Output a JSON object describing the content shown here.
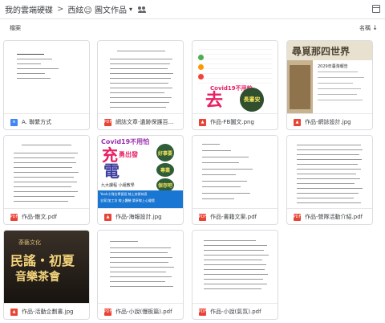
{
  "breadcrumb": {
    "root": "我的雲端硬碟",
    "sep": ">",
    "folder": "西絃☺ 圖文作品",
    "caret": "▾"
  },
  "section": {
    "left": "檔案",
    "right": "名稱",
    "sort_arrow": "↓"
  },
  "files": [
    {
      "name": "A. 聯繫方式",
      "type": "doc"
    },
    {
      "name": "網誌文章-遺跡保護百年.pdf",
      "type": "pdf"
    },
    {
      "name": "作品-FB圖文.png",
      "type": "img"
    },
    {
      "name": "作品-網誌設計.jpg",
      "type": "img"
    },
    {
      "name": "作品-散文.pdf",
      "type": "pdf"
    },
    {
      "name": "作品-海報設計.jpg",
      "type": "img"
    },
    {
      "name": "作品-書籍文案.pdf",
      "type": "pdf"
    },
    {
      "name": "作品-營隊活動介紹.pdf",
      "type": "pdf"
    },
    {
      "name": "作品-活動企劃書.jpg",
      "type": "img"
    },
    {
      "name": "作品-小說(慢板篇).pdf",
      "type": "pdf"
    },
    {
      "name": "作品-小說(氣氛).pdf",
      "type": "pdf"
    }
  ],
  "thumb_text": {
    "fb_title": "Covid19不用怕",
    "fb_big": "去",
    "fb_badge": "長輩安",
    "poster_title": "Covid19不用怕",
    "poster_big1": "充",
    "poster_big2": "電",
    "poster_sub": "勇出發",
    "poster_b1": "好事要",
    "poster_b2": "專業",
    "poster_b3": "保存吧",
    "poster_l1": "九大課程 小組教學",
    "poster_l2": "Yeah小飛位學習班 線上技術休息",
    "poster_l3": "全家/加工坊 線上體驗 樂享線上心聲館",
    "blog_banner": "尋覓那四世界",
    "blog_year": "2029年臺灣報告",
    "event_title": "荼藝文化",
    "event_big1": "民謠・初夏",
    "event_big2": "音樂茶會"
  },
  "colors": {
    "pdf": "#e94335",
    "doc": "#4285f4",
    "border": "#dadce0"
  }
}
